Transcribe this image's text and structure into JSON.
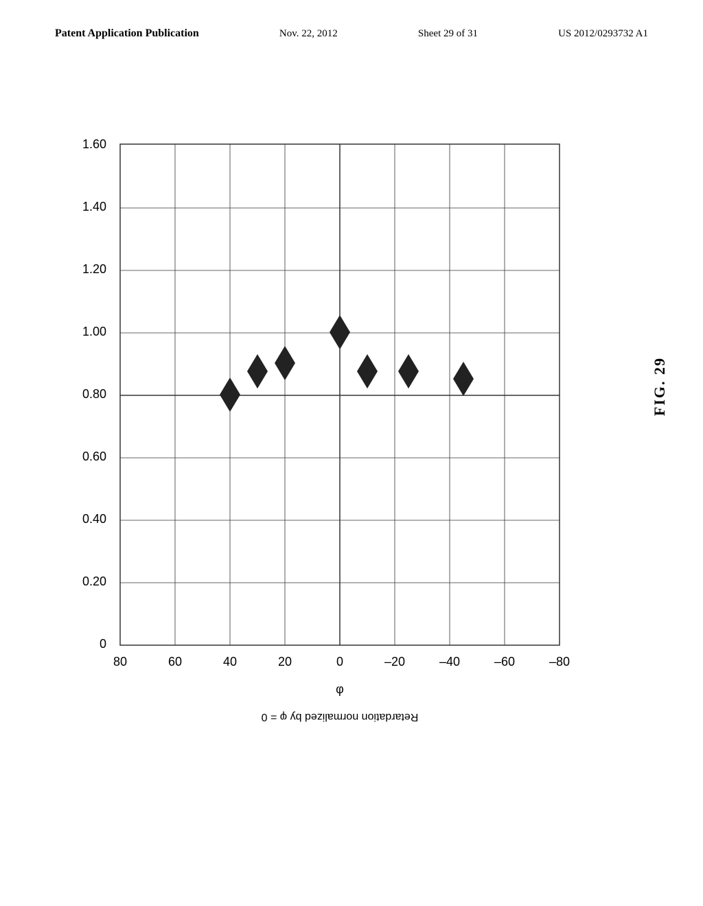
{
  "header": {
    "left": "Patent Application Publication",
    "center": "Nov. 22, 2012",
    "sheet": "Sheet 29 of 31",
    "right": "US 2012/0293732 A1"
  },
  "figure": {
    "label": "FIG. 29",
    "x_axis_label": "Retardation normalized by φ = 0",
    "y_axis_label": "φ",
    "x_ticks": [
      "0",
      "0.20",
      "0.40",
      "0.60",
      "0.80",
      "1.00",
      "1.20",
      "1.40",
      "1.60"
    ],
    "y_ticks": [
      "-80",
      "-60",
      "-40",
      "-20",
      "0",
      "20",
      "40",
      "60",
      "80"
    ],
    "data_points": [
      {
        "x": 0.8,
        "y": 40
      },
      {
        "x": 0.875,
        "y": 30
      },
      {
        "x": 0.875,
        "y": 20
      },
      {
        "x": 1.0,
        "y": 0
      },
      {
        "x": 0.875,
        "y": -10
      },
      {
        "x": 0.875,
        "y": -25
      },
      {
        "x": 0.85,
        "y": -45
      }
    ]
  }
}
